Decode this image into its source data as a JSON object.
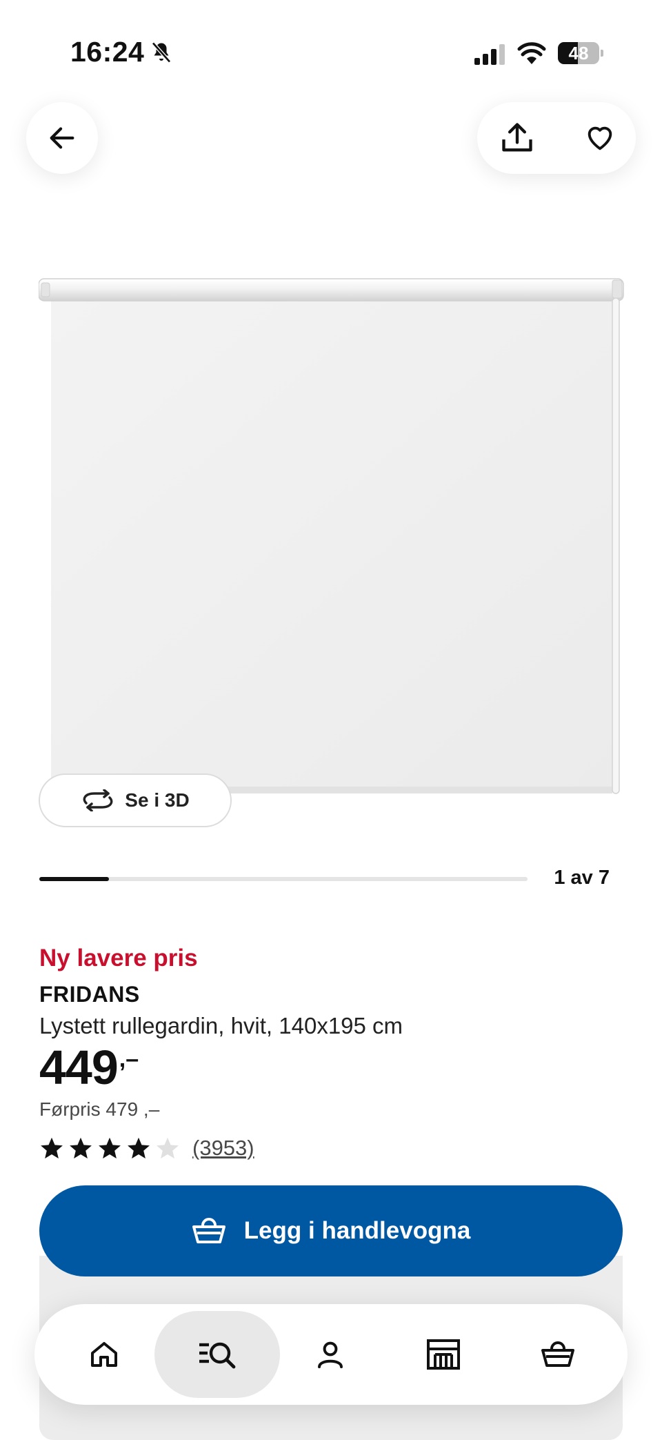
{
  "status_bar": {
    "time": "16:24",
    "battery_level": "48",
    "battery_fraction": 0.48,
    "icons": [
      "bell-slash-icon",
      "signal-icon",
      "wifi-icon",
      "battery-icon"
    ]
  },
  "header": {
    "icons": [
      "arrow-left-icon",
      "share-icon",
      "heart-icon"
    ]
  },
  "gallery": {
    "view_3d_label": "Se i 3D",
    "view_3d_icon": "rotate-3d-icon",
    "counter": "1 av 7",
    "current_index": 1,
    "total": 7
  },
  "product": {
    "promo_label": "Ny lavere pris",
    "name": "FRIDANS",
    "description": "Lystett rullegardin, hvit, 140x195 cm",
    "price_integer": "449",
    "price_suffix": ",–",
    "previous_price": "Førpris 479 ,–",
    "rating_value": 4,
    "rating_max": 5,
    "review_count": "(3953)"
  },
  "cta": {
    "add_to_cart_label": "Legg i handlevogna",
    "add_to_cart_icon": "shopping-basket-icon"
  },
  "bottom_nav": {
    "items": [
      "home-icon",
      "search-icon",
      "profile-icon",
      "stores-icon",
      "cart-icon"
    ],
    "active": "search-icon"
  },
  "colors": {
    "promo_red": "#c8102e",
    "brand_blue": "#0058a3",
    "text": "#111111",
    "star_filled": "#111111",
    "star_empty": "#e0e0e0"
  }
}
